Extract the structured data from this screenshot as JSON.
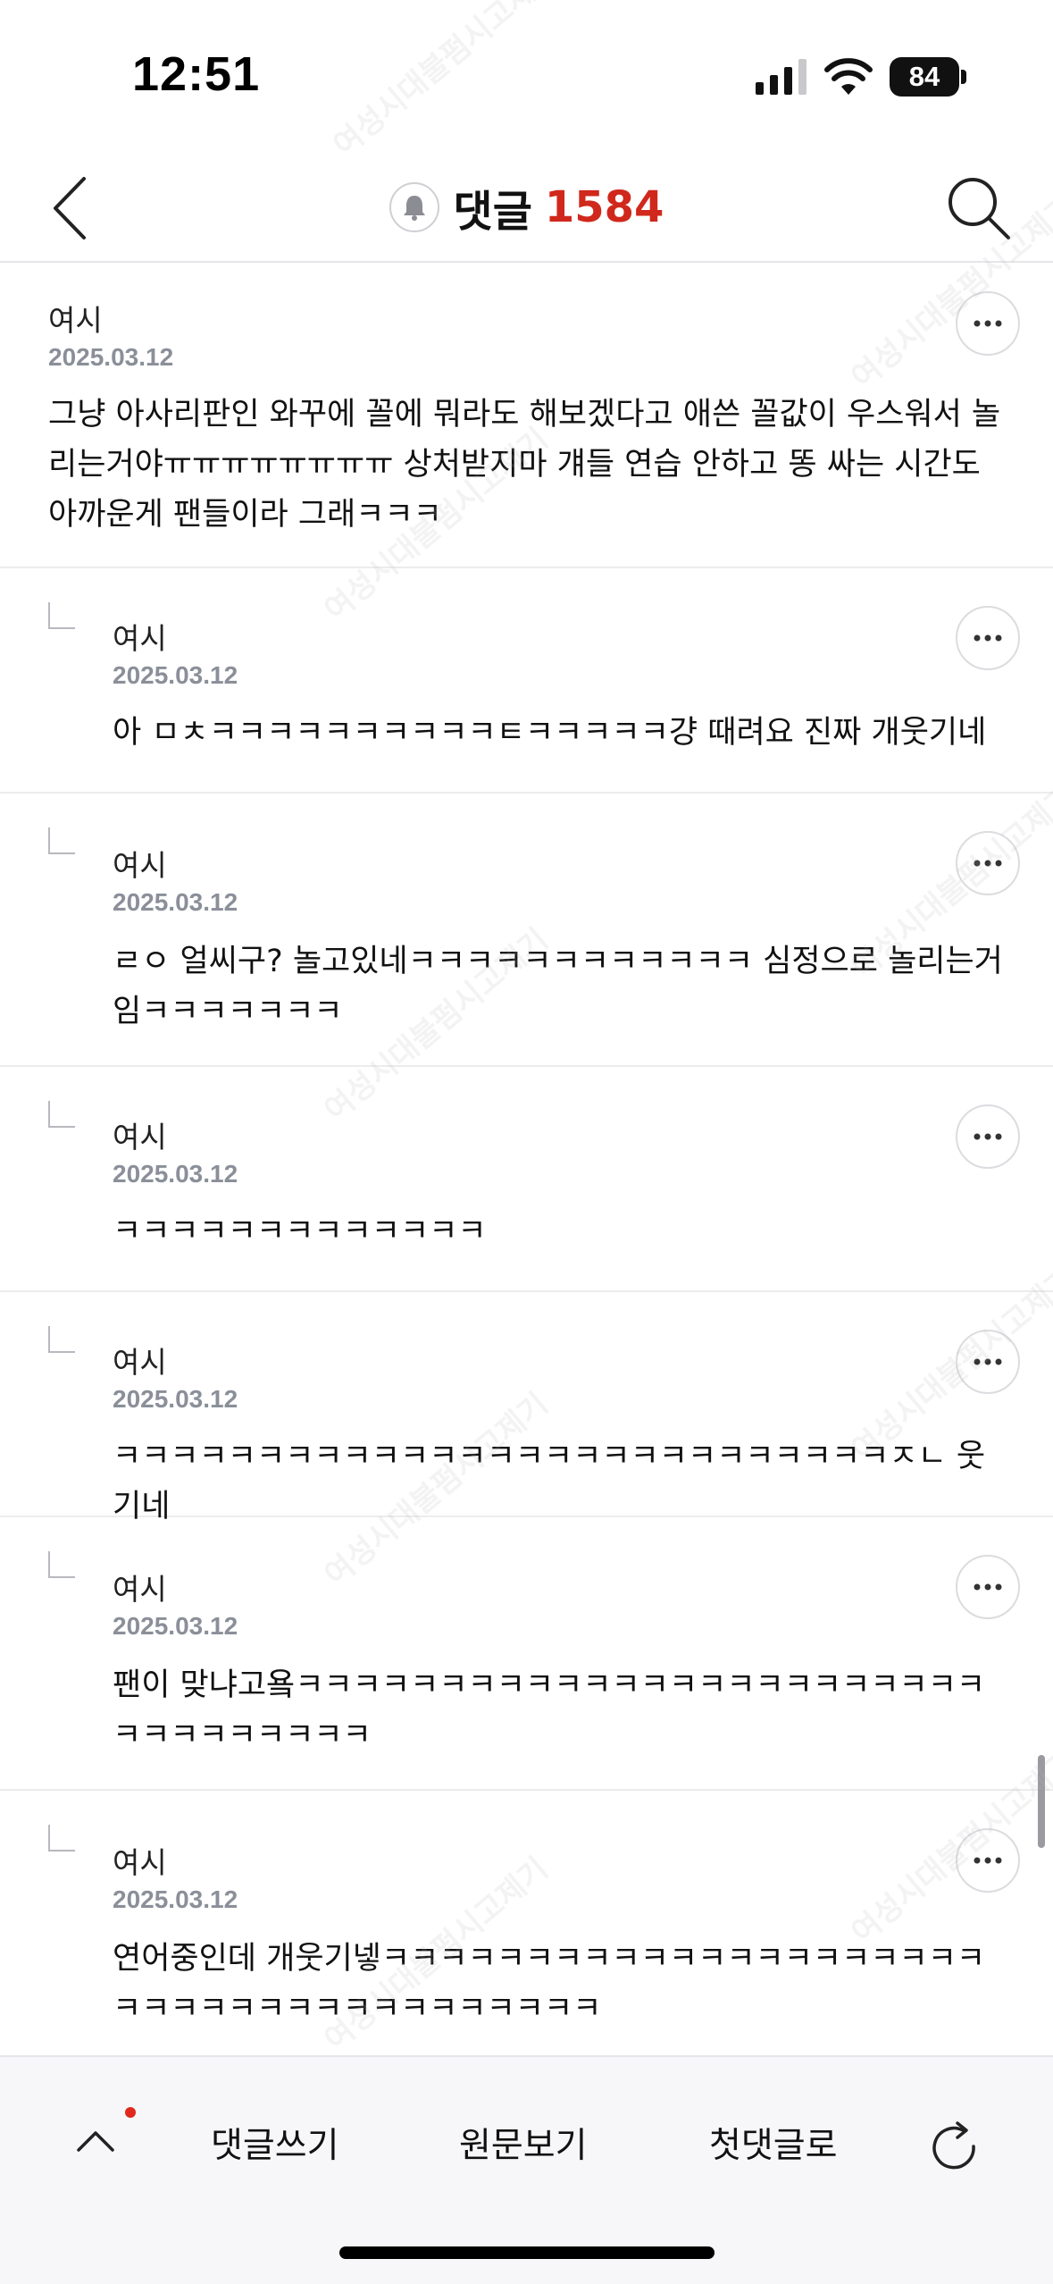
{
  "status_bar": {
    "time": "12:51",
    "battery": "84"
  },
  "header": {
    "title": "댓글",
    "count": "1584"
  },
  "comments": [
    {
      "author": "여시",
      "date": "2025.03.12",
      "text": "그냥 아사리판인 와꾸에 꼴에 뭐라도 해보겠다고 애쓴 꼴값이 우스워서 놀리는거야ㅠㅠㅠㅠㅠㅠㅠㅠ 상처받지마 걔들 연습 안하고 똥 싸는 시간도 아까운게 팬들이라 그래ㅋㅋㅋ"
    },
    {
      "author": "여시",
      "date": "2025.03.12",
      "text": "아 ㅁㅊㅋㅋㅋㅋㅋㅋㅋㅋㅋㅋㅌㅋㅋㅋㅋㅋ걍 때려요 진짜 개웃기네"
    },
    {
      "author": "여시",
      "date": "2025.03.12",
      "text": "ㄹㅇ 얼씨구? 놀고있네ㅋㅋㅋㅋㅋㅋㅋㅋㅋㅋㅋㅋ 심정으로 놀리는거임ㅋㅋㅋㅋㅋㅋㅋ"
    },
    {
      "author": "여시",
      "date": "2025.03.12",
      "text": "ㅋㅋㅋㅋㅋㅋㅋㅋㅋㅋㅋㅋㅋ"
    },
    {
      "author": "여시",
      "date": "2025.03.12",
      "text": "ㅋㅋㅋㅋㅋㅋㅋㅋㅋㅋㅋㅋㅋㅋㅋㅋㅋㅋㅋㅋㅋㅋㅋㅋㅋㅋㅋㅈㄴ 웃기네"
    },
    {
      "author": "여시",
      "date": "2025.03.12",
      "text": "팬이 맞냐고욬ㅋㅋㅋㅋㅋㅋㅋㅋㅋㅋㅋㅋㅋㅋㅋㅋㅋㅋㅋㅋㅋㅋㅋㅋㅋㅋㅋㅋㅋㅋㅋㅋㅋ"
    },
    {
      "author": "여시",
      "date": "2025.03.12",
      "text": "연어중인데 개웃기넿ㅋㅋㅋㅋㅋㅋㅋㅋㅋㅋㅋㅋㅋㅋㅋㅋㅋㅋㅋㅋㅋㅋㅋㅋㅋㅋㅋㅋㅋㅋㅋㅋㅋㅋㅋㅋㅋㅋ"
    }
  ],
  "bottom_bar": {
    "write_comment": "댓글쓰기",
    "view_original": "원문보기",
    "first_comment": "첫댓글로"
  },
  "watermark": "여성시대불펌시고제기",
  "icons": {
    "back": "chevron-left-icon",
    "bell": "bell-icon",
    "search": "search-icon",
    "more": "more-dots-icon",
    "reply": "reply-corner-icon",
    "up": "chevron-up-icon",
    "refresh": "refresh-icon"
  },
  "colors": {
    "accent": "#d0281c",
    "date": "#8a8f99",
    "divider": "#ececef",
    "bottom_bg": "#f7f7f9"
  }
}
